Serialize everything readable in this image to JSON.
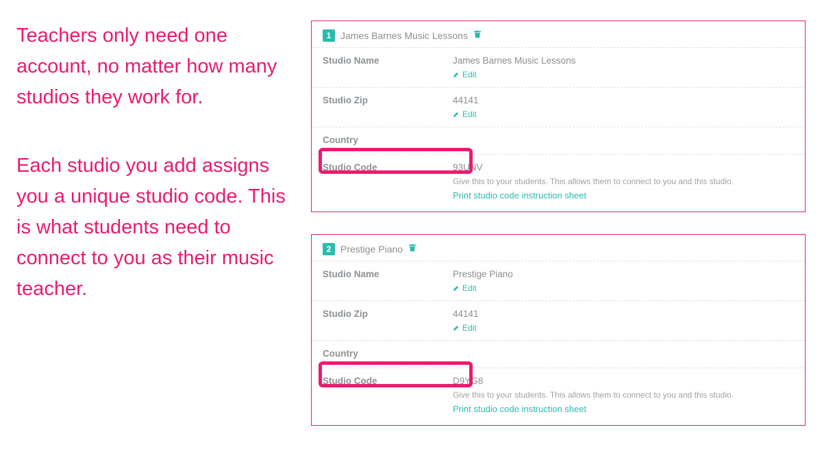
{
  "left_text": {
    "para1": "Teachers only need one account, no matter how many studios they work for.",
    "para2": "Each studio you add assigns you a unique studio code. This is what students need to connect to you as their music teacher."
  },
  "labels": {
    "studio_name": "Studio Name",
    "studio_zip": "Studio Zip",
    "country": "Country",
    "studio_code": "Studio Code",
    "edit": "Edit",
    "help": "Give this to your students. This allows them to connect to you and this studio.",
    "print": "Print studio code instruction sheet"
  },
  "studios": [
    {
      "num": "1",
      "title": "James Barnes Music Lessons",
      "name": "James Barnes Music Lessons",
      "zip": "44141",
      "country": "",
      "code": "93UNV"
    },
    {
      "num": "2",
      "title": "Prestige Piano",
      "name": "Prestige Piano",
      "zip": "44141",
      "country": "",
      "code": "D9YG8"
    }
  ]
}
